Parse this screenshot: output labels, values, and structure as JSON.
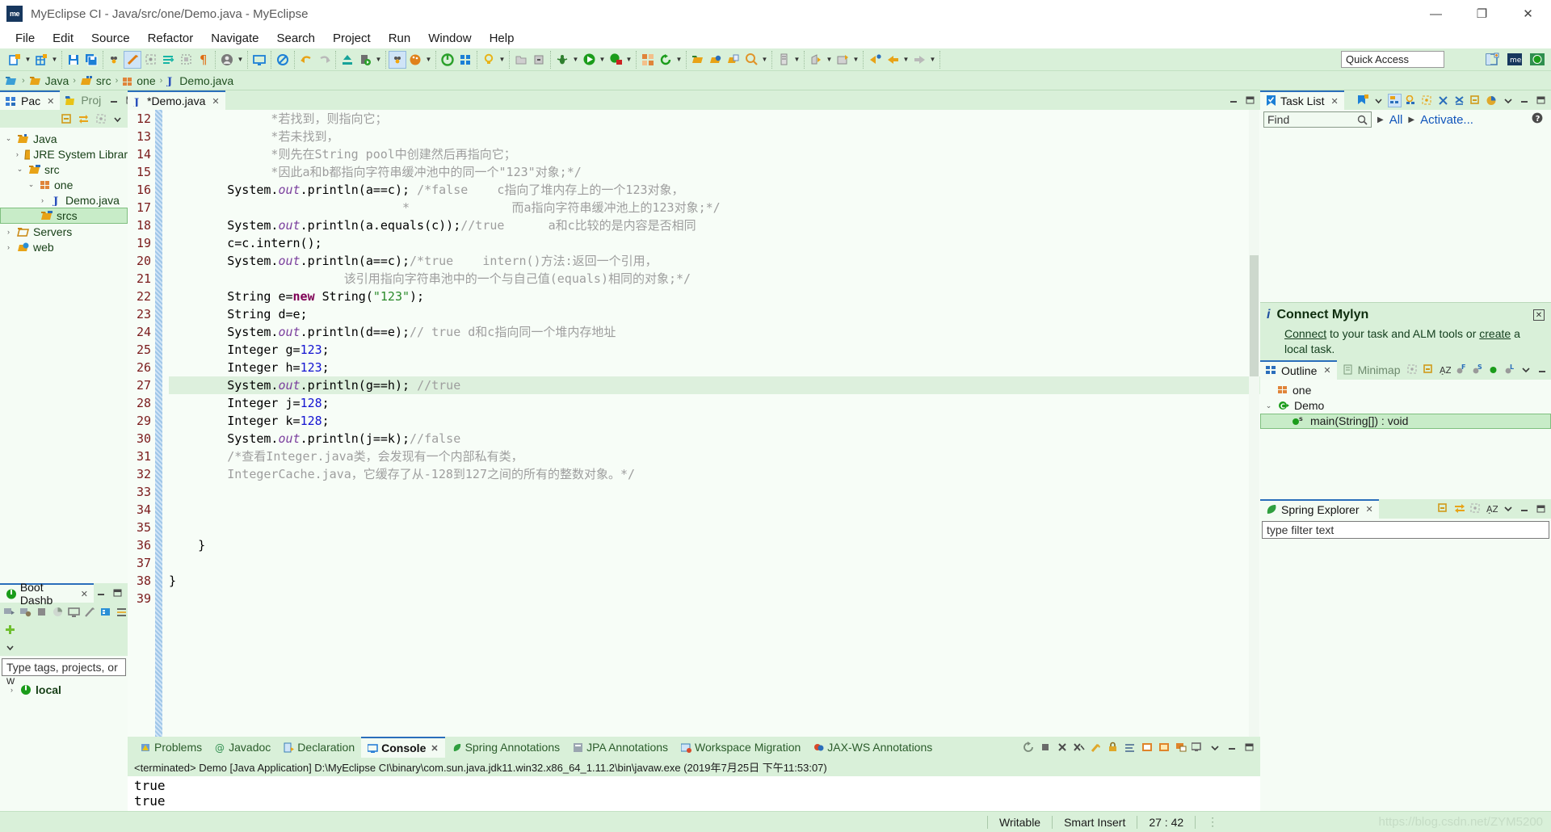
{
  "window": {
    "title": "MyEclipse CI - Java/src/one/Demo.java - MyEclipse",
    "app_badge": "me",
    "minimize": "—",
    "maximize": "❐",
    "close": "✕"
  },
  "menubar": [
    "File",
    "Edit",
    "Source",
    "Refactor",
    "Navigate",
    "Search",
    "Project",
    "Run",
    "Window",
    "Help"
  ],
  "toolbar": {
    "quick_access_placeholder": "Quick Access",
    "quick_access_value": "Quick Access"
  },
  "breadcrumb": [
    "Java",
    "src",
    "one",
    "Demo.java"
  ],
  "left": {
    "tabs": [
      {
        "label": "Pac",
        "active": true
      },
      {
        "label": "Proj",
        "active": false
      }
    ],
    "tree": [
      {
        "label": "Java",
        "depth": 0,
        "arrow": "⌄",
        "icon": "project-folder-icon"
      },
      {
        "label": "JRE System Librar",
        "depth": 1,
        "arrow": "›",
        "icon": "library-icon"
      },
      {
        "label": "src",
        "depth": 1,
        "arrow": "⌄",
        "icon": "source-folder-icon"
      },
      {
        "label": "one",
        "depth": 2,
        "arrow": "⌄",
        "icon": "package-icon"
      },
      {
        "label": "Demo.java",
        "depth": 3,
        "arrow": "›",
        "icon": "java-file-icon"
      },
      {
        "label": "srcs",
        "depth": 2,
        "arrow": "",
        "icon": "source-folder-icon",
        "selected": true
      },
      {
        "label": "Servers",
        "depth": 0,
        "arrow": "›",
        "icon": "folder-icon"
      },
      {
        "label": "web",
        "depth": 0,
        "arrow": "›",
        "icon": "web-folder-icon"
      }
    ],
    "boot_dashboard": {
      "tab_label": "Boot Dashb",
      "filter_placeholder": "Type tags, projects, or w",
      "items": [
        {
          "label": "local",
          "arrow": "›"
        }
      ]
    }
  },
  "editor": {
    "tab_label": "*Demo.java",
    "tab_icon": "java-file-icon",
    "first_line": 12,
    "lines": [
      {
        "n": 12,
        "segments": [
          {
            "t": "              *若找到，则指向它；",
            "c": "cm"
          }
        ]
      },
      {
        "n": 13,
        "segments": [
          {
            "t": "              *若未找到，",
            "c": "cm"
          }
        ]
      },
      {
        "n": 14,
        "segments": [
          {
            "t": "              *则先在String pool中创建然后再指向它；",
            "c": "cm"
          }
        ]
      },
      {
        "n": 15,
        "segments": [
          {
            "t": "              *因此a和b都指向字符串缓冲池中的同一个\"123\"对象;*/",
            "c": "cm"
          }
        ]
      },
      {
        "n": 16,
        "segments": [
          {
            "t": "        System.",
            "c": ""
          },
          {
            "t": "out",
            "c": "fld"
          },
          {
            "t": ".println(a==c); ",
            "c": ""
          },
          {
            "t": "/*false    c指向了堆内存上的一个123对象，",
            "c": "cm"
          }
        ]
      },
      {
        "n": 17,
        "segments": [
          {
            "t": "                                *              而a指向字符串缓冲池上的123对象;*/",
            "c": "cm"
          }
        ]
      },
      {
        "n": 18,
        "segments": [
          {
            "t": "        System.",
            "c": ""
          },
          {
            "t": "out",
            "c": "fld"
          },
          {
            "t": ".println(a.equals(c));",
            "c": ""
          },
          {
            "t": "//true      a和c比较的是内容是否相同",
            "c": "cm"
          }
        ]
      },
      {
        "n": 19,
        "segments": [
          {
            "t": "        c=c.intern();",
            "c": ""
          }
        ]
      },
      {
        "n": 20,
        "segments": [
          {
            "t": "        System.",
            "c": ""
          },
          {
            "t": "out",
            "c": "fld"
          },
          {
            "t": ".println(a==c);",
            "c": ""
          },
          {
            "t": "/*true    intern()方法:返回一个引用，",
            "c": "cm"
          }
        ]
      },
      {
        "n": 21,
        "segments": [
          {
            "t": "                        该引用指向字符串池中的一个与自己值(equals)相同的对象;*/",
            "c": "cm"
          }
        ]
      },
      {
        "n": 22,
        "segments": [
          {
            "t": "        String e=",
            "c": ""
          },
          {
            "t": "new",
            "c": "k"
          },
          {
            "t": " String(",
            "c": ""
          },
          {
            "t": "\"123\"",
            "c": "str"
          },
          {
            "t": ");",
            "c": ""
          }
        ]
      },
      {
        "n": 23,
        "segments": [
          {
            "t": "        String d=e;",
            "c": ""
          }
        ]
      },
      {
        "n": 24,
        "segments": [
          {
            "t": "        System.",
            "c": ""
          },
          {
            "t": "out",
            "c": "fld"
          },
          {
            "t": ".println(d==e);",
            "c": ""
          },
          {
            "t": "// true d和c指向同一个堆内存地址",
            "c": "cm"
          }
        ]
      },
      {
        "n": 25,
        "segments": [
          {
            "t": "        Integer g=",
            "c": ""
          },
          {
            "t": "123",
            "c": "num"
          },
          {
            "t": ";",
            "c": ""
          }
        ]
      },
      {
        "n": 26,
        "segments": [
          {
            "t": "        Integer h=",
            "c": ""
          },
          {
            "t": "123",
            "c": "num"
          },
          {
            "t": ";",
            "c": ""
          }
        ]
      },
      {
        "n": 27,
        "highlight": true,
        "segments": [
          {
            "t": "        System.",
            "c": ""
          },
          {
            "t": "out",
            "c": "fld"
          },
          {
            "t": ".println(g==h); ",
            "c": ""
          },
          {
            "t": "//true",
            "c": "cm"
          }
        ]
      },
      {
        "n": 28,
        "segments": [
          {
            "t": "        Integer j=",
            "c": ""
          },
          {
            "t": "128",
            "c": "num"
          },
          {
            "t": ";",
            "c": ""
          }
        ]
      },
      {
        "n": 29,
        "segments": [
          {
            "t": "        Integer k=",
            "c": ""
          },
          {
            "t": "128",
            "c": "num"
          },
          {
            "t": ";",
            "c": ""
          }
        ]
      },
      {
        "n": 30,
        "segments": [
          {
            "t": "        System.",
            "c": ""
          },
          {
            "t": "out",
            "c": "fld"
          },
          {
            "t": ".println(j==k);",
            "c": ""
          },
          {
            "t": "//false",
            "c": "cm"
          }
        ]
      },
      {
        "n": 31,
        "segments": [
          {
            "t": "        /*查看Integer.java类，会发现有一个内部私有类，",
            "c": "cm"
          }
        ]
      },
      {
        "n": 32,
        "segments": [
          {
            "t": "        IntegerCache.java，它缓存了从-128到127之间的所有的整数对象。*/",
            "c": "cm"
          }
        ]
      },
      {
        "n": 33,
        "segments": [
          {
            "t": "",
            "c": ""
          }
        ]
      },
      {
        "n": 34,
        "segments": [
          {
            "t": "",
            "c": ""
          }
        ]
      },
      {
        "n": 35,
        "segments": [
          {
            "t": "",
            "c": ""
          }
        ]
      },
      {
        "n": 36,
        "segments": [
          {
            "t": "    }",
            "c": ""
          }
        ]
      },
      {
        "n": 37,
        "segments": [
          {
            "t": "",
            "c": ""
          }
        ]
      },
      {
        "n": 38,
        "segments": [
          {
            "t": "}",
            "c": ""
          }
        ]
      },
      {
        "n": 39,
        "segments": [
          {
            "t": "",
            "c": ""
          }
        ]
      }
    ]
  },
  "console": {
    "tabs": [
      {
        "label": "Problems",
        "icon": "problems-icon",
        "active": false
      },
      {
        "label": "Javadoc",
        "icon": "javadoc-icon",
        "active": false
      },
      {
        "label": "Declaration",
        "icon": "declaration-icon",
        "active": false
      },
      {
        "label": "Console",
        "icon": "console-icon",
        "active": true
      },
      {
        "label": "Spring Annotations",
        "icon": "spring-icon",
        "active": false
      },
      {
        "label": "JPA Annotations",
        "icon": "jpa-icon",
        "active": false
      },
      {
        "label": "Workspace Migration",
        "icon": "migration-icon",
        "active": false
      },
      {
        "label": "JAX-WS Annotations",
        "icon": "jaxws-icon",
        "active": false
      }
    ],
    "terminated_line": "<terminated> Demo [Java Application] D:\\MyEclipse CI\\binary\\com.sun.java.jdk11.win32.x86_64_1.11.2\\bin\\javaw.exe (2019年7月25日 下午11:53:07)",
    "output": [
      "true",
      "true"
    ]
  },
  "right": {
    "task_list": {
      "tab_label": "Task List",
      "find_placeholder": "Find",
      "filter_all": "All",
      "activate": "Activate..."
    },
    "mylyn": {
      "heading": "Connect Mylyn",
      "body_pre": "",
      "link1": "Connect",
      "mid": " to your task and ALM tools or ",
      "link2": "create",
      "body_post": " a local task."
    },
    "outline": {
      "tabs": [
        {
          "label": "Outline",
          "active": true
        },
        {
          "label": "Minimap",
          "active": false
        }
      ],
      "items": [
        {
          "label": "one",
          "depth": 1,
          "arrow": "",
          "icon": "package-icon"
        },
        {
          "label": "Demo",
          "depth": 0,
          "arrow": "⌄",
          "icon": "class-icon"
        },
        {
          "label": "main(String[]) : void",
          "depth": 2,
          "arrow": "",
          "icon": "method-static-icon",
          "selected": true
        }
      ]
    },
    "spring_explorer": {
      "tab_label": "Spring Explorer",
      "filter_placeholder": "type filter text"
    }
  },
  "statusbar": {
    "writable": "Writable",
    "insert_mode": "Smart Insert",
    "position": "27 : 42",
    "watermark": "https://blog.csdn.net/ZYM5200"
  }
}
